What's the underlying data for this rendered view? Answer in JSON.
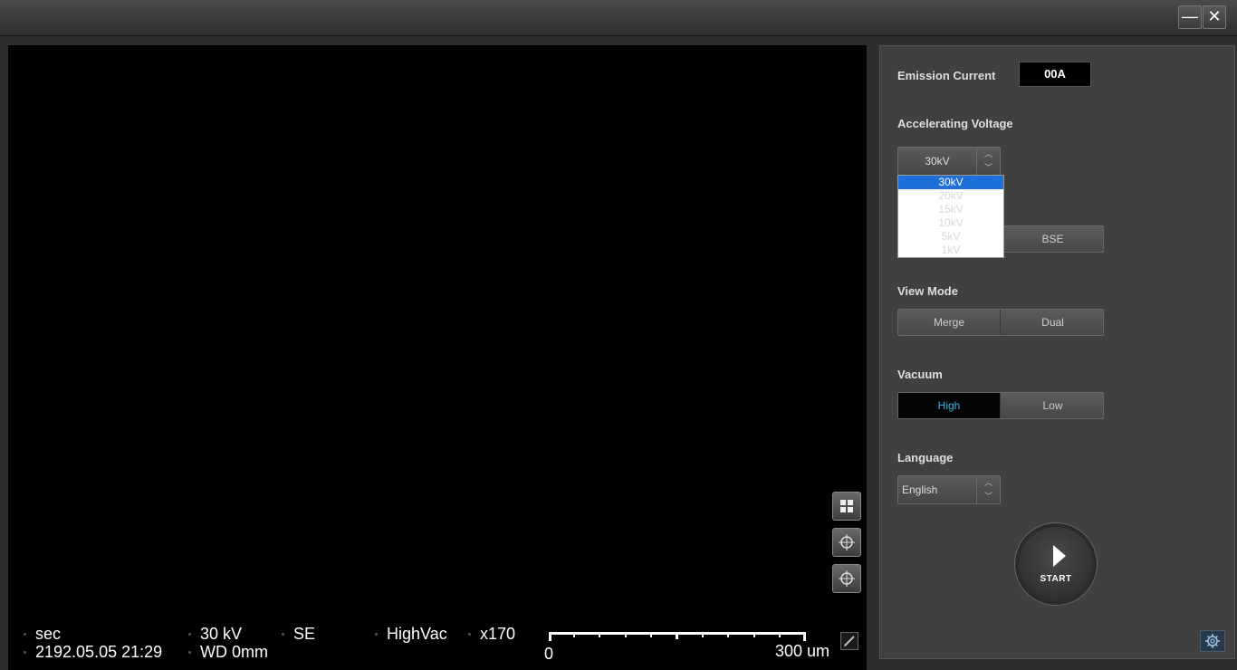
{
  "window": {
    "minimize_glyph": "—",
    "close_glyph": "✕"
  },
  "viewer": {
    "status": {
      "time_unit": "sec",
      "datetime": "2192.05.05 21:29",
      "voltage": "30 kV",
      "working_distance": "WD 0mm",
      "detector": "SE",
      "vacuum": "HighVac",
      "magnification": "x170"
    },
    "scalebar": {
      "start_label": "0",
      "end_label": "300 um"
    },
    "tools": [
      "grid-icon",
      "crosshair-icon",
      "crosshair-icon"
    ]
  },
  "panel": {
    "emission_current": {
      "label": "Emission Current",
      "value": "00A"
    },
    "accelerating_voltage": {
      "label": "Accelerating Voltage",
      "selected": "30kV",
      "options": [
        "30kV",
        "20kV",
        "15kV",
        "10kV",
        "5kV",
        "1kV"
      ]
    },
    "detector": {
      "right_label": "BSE"
    },
    "view_mode": {
      "label": "View Mode",
      "left": "Merge",
      "right": "Dual"
    },
    "vacuum": {
      "label": "Vacuum",
      "left": "High",
      "right": "Low",
      "active": "High"
    },
    "language": {
      "label": "Language",
      "selected": "English"
    },
    "start": {
      "label": "START"
    }
  },
  "colors": {
    "accent": "#3ab4e6",
    "selection": "#1e6fd9"
  }
}
